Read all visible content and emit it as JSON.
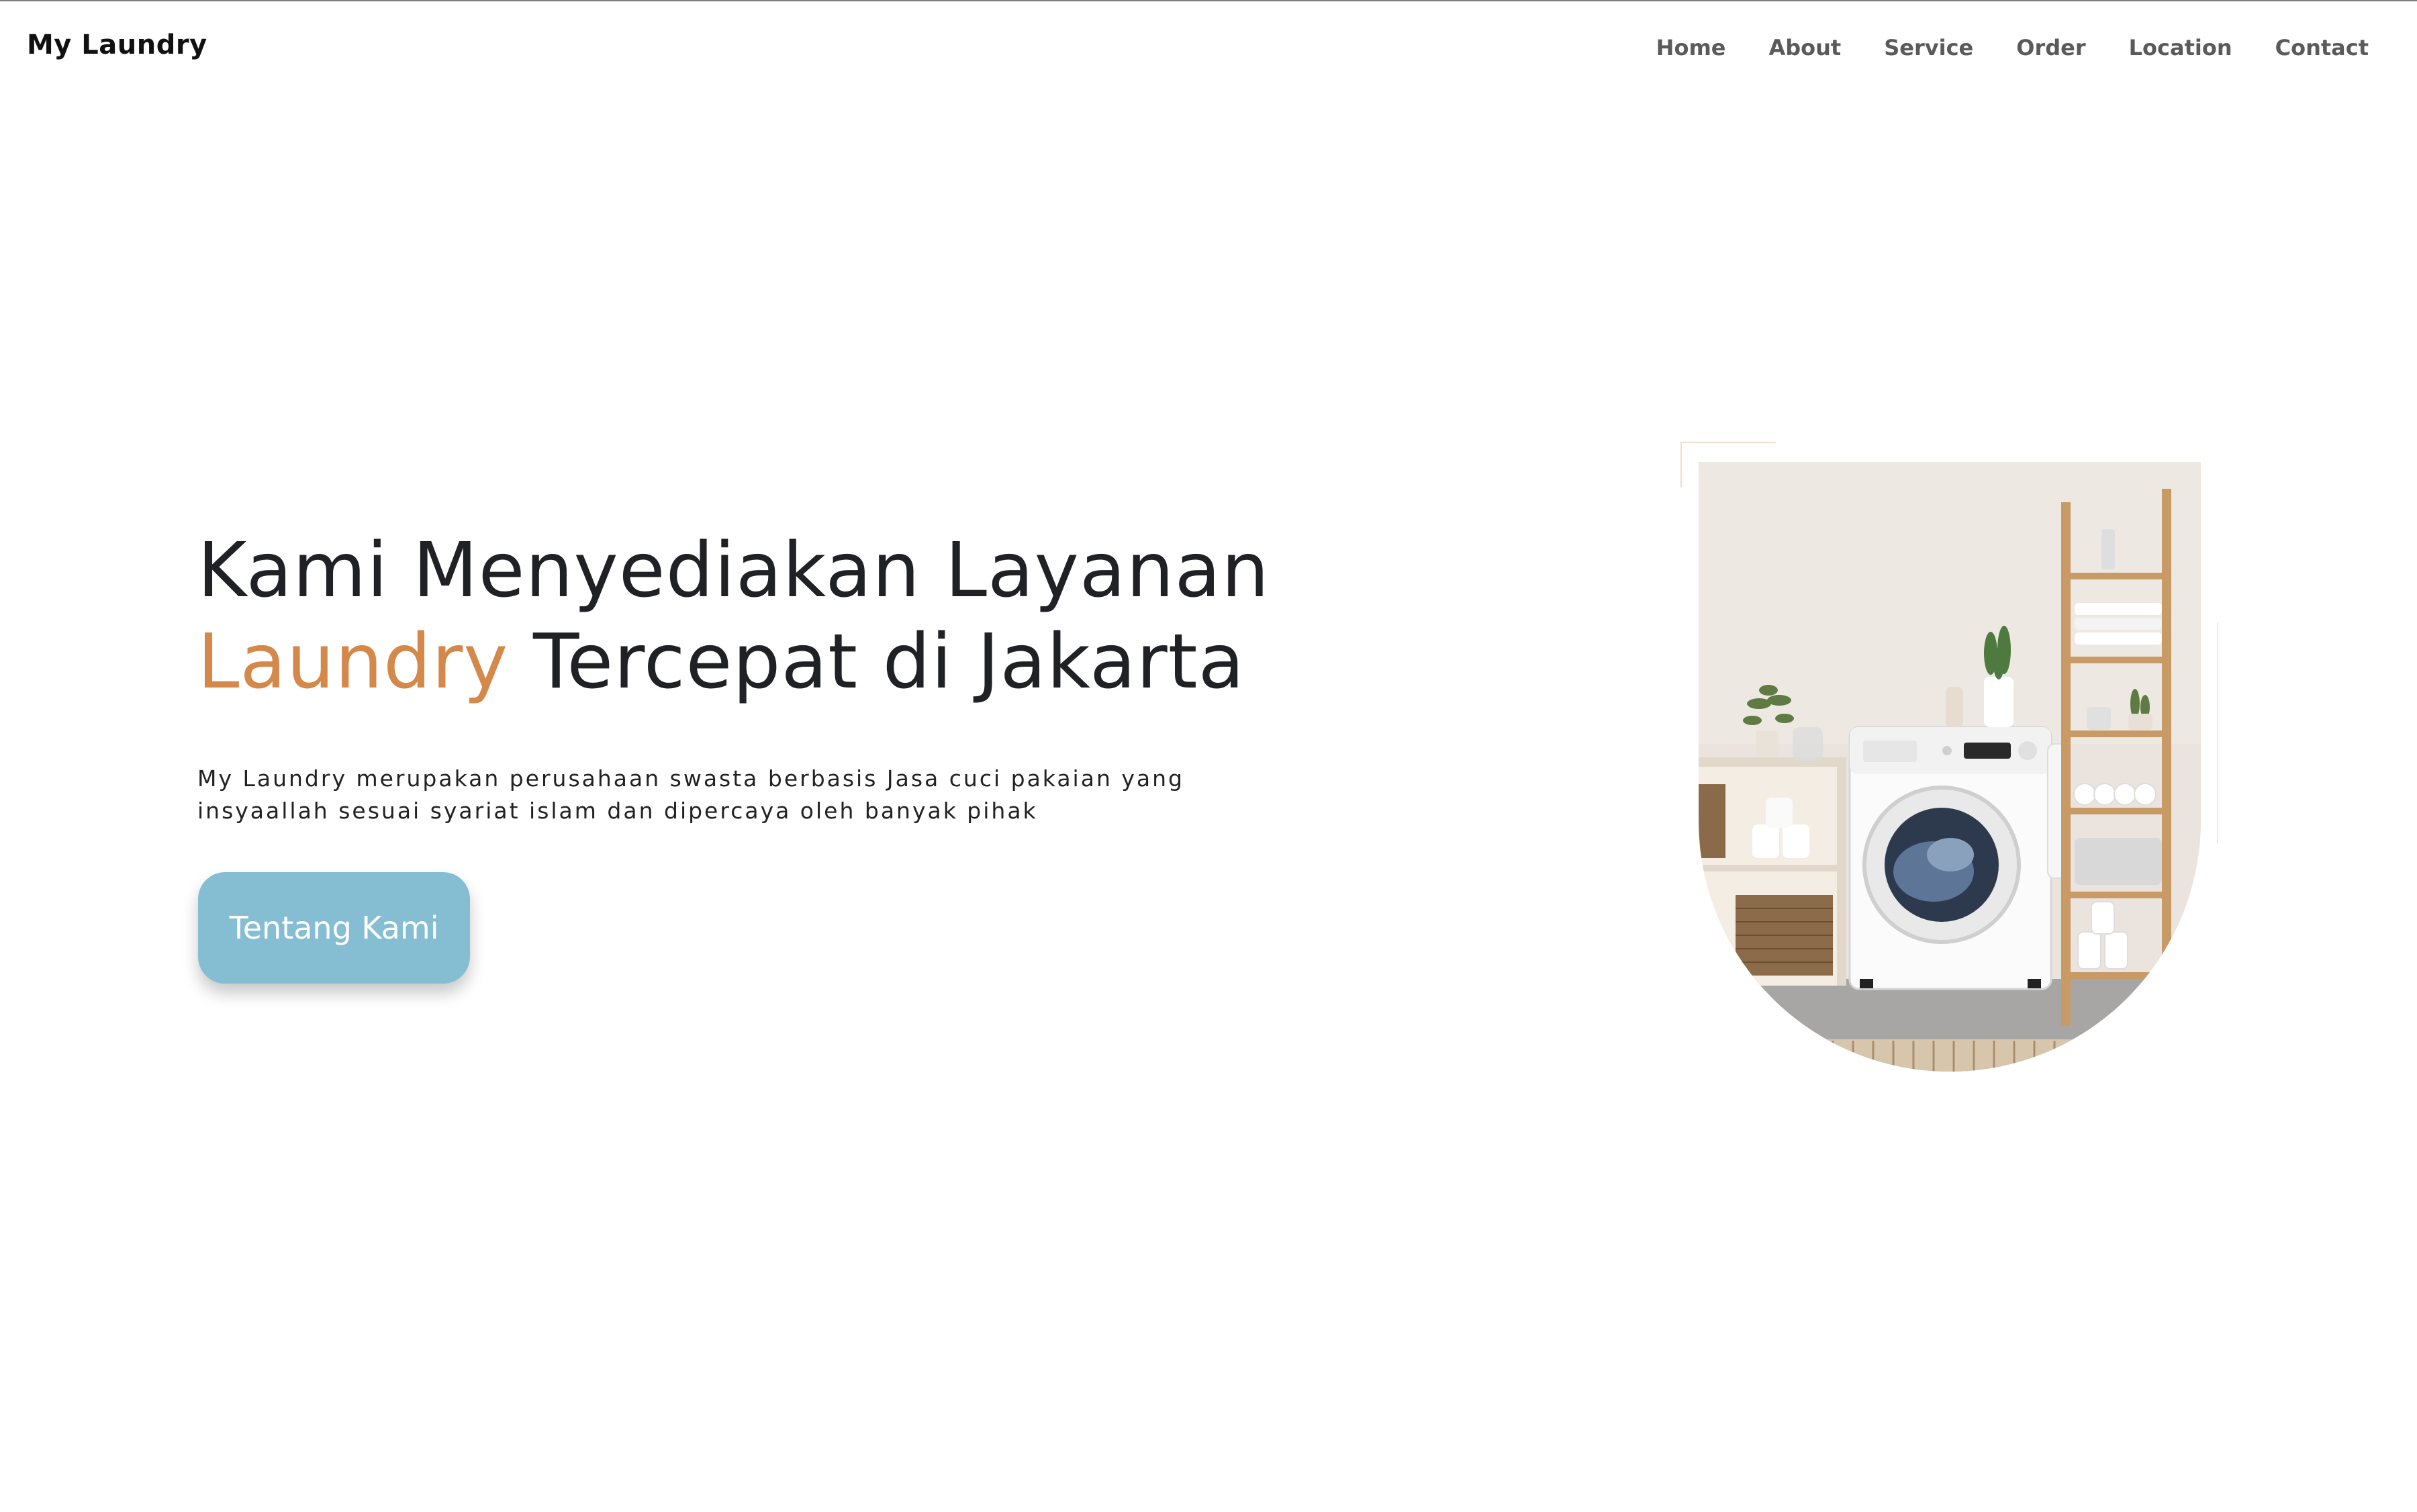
{
  "navbar": {
    "brand": "My Laundry",
    "links": [
      "Home",
      "About",
      "Service",
      "Order",
      "Location",
      "Contact"
    ]
  },
  "hero": {
    "title_line1": "Kami Menyediakan Layanan",
    "title_accent": "Laundry",
    "title_line2_rest": " Tercepat di Jakarta",
    "description": "My Laundry merupakan perusahaan swasta berbasis Jasa cuci pakaian yang insyaallah sesuai syariat islam dan dipercaya oleh banyak pihak",
    "button_label": "Tentang Kami"
  },
  "colors": {
    "accent": "#d4884a",
    "button": "#85bdd3",
    "text": "#1f2125",
    "nav_text": "#5a5a5a"
  },
  "icons": {
    "hero_image": "washing-machine-room-photo"
  }
}
